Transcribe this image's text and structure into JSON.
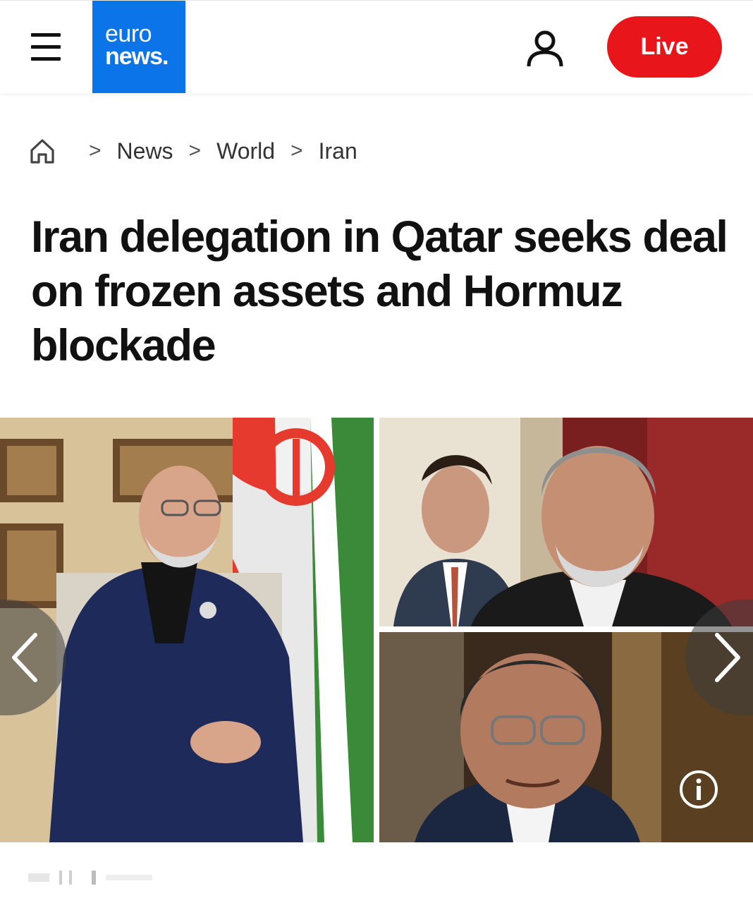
{
  "header": {
    "logo_line1": "euro",
    "logo_line2": "news.",
    "live_label": "Live",
    "logo_bg": "#0a74e8",
    "live_bg": "#e8151b"
  },
  "breadcrumb": {
    "items": [
      "News",
      "World",
      "Iran"
    ]
  },
  "article": {
    "headline": "Iran delegation in Qatar seeks deal on frozen assets and Hormuz blockade"
  },
  "gallery": {
    "icons": [
      "chevron-left-icon",
      "chevron-right-icon",
      "info-icon"
    ]
  }
}
